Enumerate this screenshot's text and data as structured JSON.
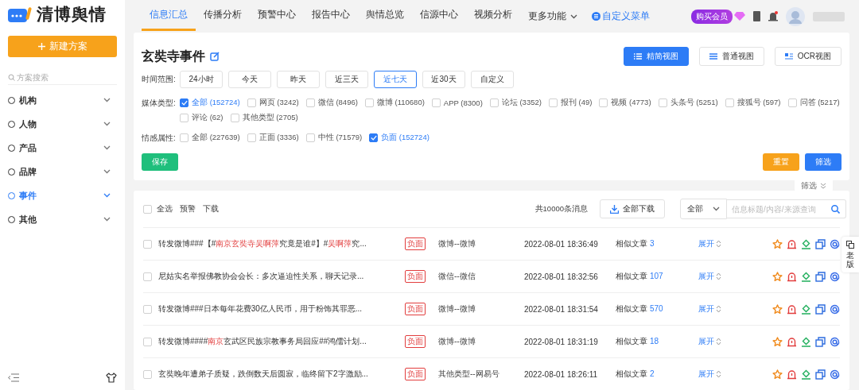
{
  "sidebar": {
    "logo": "清博舆情",
    "new_button": "新建方案",
    "search": {
      "placeholder": "方案搜索"
    },
    "items": [
      {
        "label": "机构",
        "selected": false
      },
      {
        "label": "人物",
        "selected": false
      },
      {
        "label": "产品",
        "selected": false
      },
      {
        "label": "品牌",
        "selected": false
      },
      {
        "label": "事件",
        "selected": true
      },
      {
        "label": "其他",
        "selected": false
      }
    ]
  },
  "nav": {
    "tabs": [
      {
        "label": "信息汇总",
        "selected": true
      },
      {
        "label": "传播分析",
        "selected": false
      },
      {
        "label": "预警中心",
        "selected": false
      },
      {
        "label": "报告中心",
        "selected": false
      },
      {
        "label": "舆情总览",
        "selected": false
      },
      {
        "label": "信源中心",
        "selected": false
      },
      {
        "label": "视频分析",
        "selected": false
      }
    ],
    "more": "更多功能",
    "custom_menu": "自定义菜单",
    "vip_badge": "购买会员"
  },
  "filter": {
    "title": "玄奘寺事件",
    "views": [
      {
        "label": "精简视图",
        "selected": true
      },
      {
        "label": "普通视图",
        "selected": false
      },
      {
        "label": "OCR视图",
        "selected": false
      }
    ],
    "time_label": "时间范围:",
    "time_options": [
      {
        "label": "24小时",
        "selected": false
      },
      {
        "label": "今天",
        "selected": false
      },
      {
        "label": "昨天",
        "selected": false
      },
      {
        "label": "近三天",
        "selected": false
      },
      {
        "label": "近七天",
        "selected": true
      },
      {
        "label": "近30天",
        "selected": false
      },
      {
        "label": "自定义",
        "selected": false
      }
    ],
    "media_label": "媒体类型:",
    "media_options": [
      {
        "label": "全部 (152724)",
        "checked": true
      },
      {
        "label": "网页 (3242)",
        "checked": false
      },
      {
        "label": "微信 (8496)",
        "checked": false
      },
      {
        "label": "微博 (110680)",
        "checked": false
      },
      {
        "label": "APP (8300)",
        "checked": false
      },
      {
        "label": "论坛 (3352)",
        "checked": false
      },
      {
        "label": "报刊 (49)",
        "checked": false
      },
      {
        "label": "视频 (4773)",
        "checked": false
      },
      {
        "label": "头条号 (5251)",
        "checked": false
      },
      {
        "label": "搜狐号 (597)",
        "checked": false
      },
      {
        "label": "问答 (5217)",
        "checked": false
      },
      {
        "label": "评论 (62)",
        "checked": false
      },
      {
        "label": "其他类型 (2705)",
        "checked": false
      }
    ],
    "sentiment_label": "情感属性:",
    "sentiment_options": [
      {
        "label": "全部 (227639)",
        "checked": false
      },
      {
        "label": "正面 (3336)",
        "checked": false
      },
      {
        "label": "中性 (71579)",
        "checked": false
      },
      {
        "label": "负面 (152724)",
        "checked": true
      }
    ],
    "save": "保存",
    "reset": "重置",
    "apply": "筛选",
    "collapse": "筛选"
  },
  "results": {
    "select_all": {
      "label": "全选",
      "checked": false
    },
    "actions": [
      "预警",
      "下载"
    ],
    "total": "共10000条消息",
    "download_all": "全部下载",
    "scope": "全部",
    "search": {
      "placeholder": "信息标题/内容/来源查询"
    },
    "rows": [
      {
        "checked": false,
        "title_parts": [
          {
            "text": "转发微博###【#",
            "highlight": false
          },
          {
            "text": "南京玄奘寺吴啊萍",
            "highlight": true
          },
          {
            "text": "究竟是谁#】#",
            "highlight": false
          },
          {
            "text": "吴啊萍",
            "highlight": true
          },
          {
            "text": "究...",
            "highlight": false
          }
        ],
        "tag": "负面",
        "source": "微博--微博",
        "time": "2022-08-01 18:36:49",
        "similar_label": "相似文章",
        "similar_count": "3",
        "expand": "展开"
      },
      {
        "checked": false,
        "title_parts": [
          {
            "text": "尼姑实名举报佛教协会会长：多次逼迫性关系，聊天记录...",
            "highlight": false
          }
        ],
        "tag": "负面",
        "source": "微信--微信",
        "time": "2022-08-01 18:32:56",
        "similar_label": "相似文章",
        "similar_count": "107",
        "expand": "展开"
      },
      {
        "checked": false,
        "title_parts": [
          {
            "text": "转发微博###日本每年花费30亿人民币，用于粉饰其罪恶...",
            "highlight": false
          }
        ],
        "tag": "负面",
        "source": "微博--微博",
        "time": "2022-08-01 18:31:54",
        "similar_label": "相似文章",
        "similar_count": "570",
        "expand": "展开"
      },
      {
        "checked": false,
        "title_parts": [
          {
            "text": "转发微博####",
            "highlight": false
          },
          {
            "text": "南京",
            "highlight": true
          },
          {
            "text": "玄武区民族宗教事务局回应##鸿儒计划...",
            "highlight": false
          }
        ],
        "tag": "负面",
        "source": "微博--微博",
        "time": "2022-08-01 18:31:19",
        "similar_label": "相似文章",
        "similar_count": "18",
        "expand": "展开"
      },
      {
        "checked": false,
        "title_parts": [
          {
            "text": "玄奘晚年遭弟子质疑，跌倒数天后圆寂，临终留下2字激励...",
            "highlight": false
          }
        ],
        "tag": "负面",
        "source": "其他类型--网易号",
        "time": "2022-08-01 18:26:11",
        "similar_label": "相似文章",
        "similar_count": "2",
        "expand": "展开"
      }
    ]
  },
  "side_widget": "老版"
}
